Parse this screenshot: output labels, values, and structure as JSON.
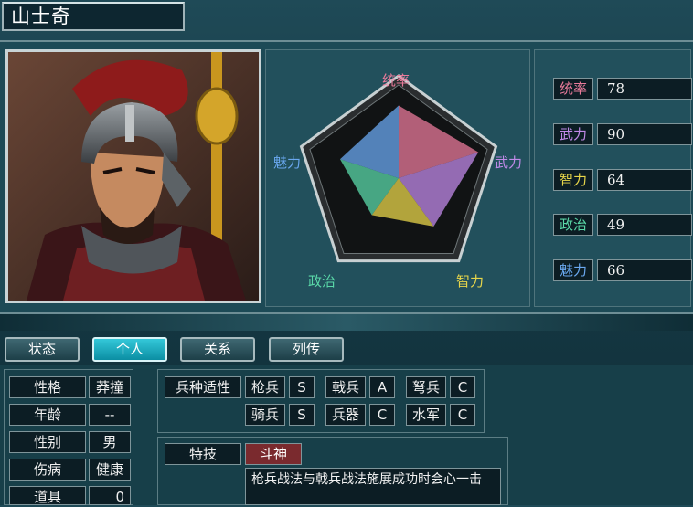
{
  "character": {
    "name": "山士奇"
  },
  "radar": {
    "labels": {
      "top": "统率",
      "right": "武力",
      "bottom_right": "智力",
      "bottom_left": "政治",
      "left": "魅力"
    },
    "values": {
      "tongshuai": 78,
      "wuli": 90,
      "zhili": 64,
      "zhengzhi": 49,
      "meili": 66
    },
    "max": 100
  },
  "stats": [
    {
      "label": "统率",
      "value": "78",
      "color": "#e87a9a"
    },
    {
      "label": "武力",
      "value": "90",
      "color": "#c08ae8"
    },
    {
      "label": "智力",
      "value": "64",
      "color": "#e8d64a"
    },
    {
      "label": "政治",
      "value": "49",
      "color": "#5ad8a8"
    },
    {
      "label": "魅力",
      "value": "66",
      "color": "#6aa8f0"
    }
  ],
  "tabs": [
    "状态",
    "个人",
    "关系",
    "列传"
  ],
  "active_tab": "个人",
  "personal": [
    {
      "label": "性格",
      "value": "莽撞"
    },
    {
      "label": "年龄",
      "value": "--"
    },
    {
      "label": "性别",
      "value": "男"
    },
    {
      "label": "伤病",
      "value": "健康"
    },
    {
      "label": "道具",
      "value": "0"
    }
  ],
  "troop": {
    "header": "兵种适性",
    "rows": [
      [
        {
          "type": "枪兵",
          "grade": "S"
        },
        {
          "type": "戟兵",
          "grade": "A"
        },
        {
          "type": "弩兵",
          "grade": "C"
        }
      ],
      [
        {
          "type": "骑兵",
          "grade": "S"
        },
        {
          "type": "兵器",
          "grade": "C"
        },
        {
          "type": "水军",
          "grade": "C"
        }
      ]
    ]
  },
  "skill": {
    "label": "特技",
    "name": "斗神",
    "description": "枪兵战法与戟兵战法施展成功时会心一击"
  },
  "colors": {
    "active_tab": "#1fb3c6",
    "skill_bg": "#7a2a2e",
    "panel": "#22505c"
  }
}
